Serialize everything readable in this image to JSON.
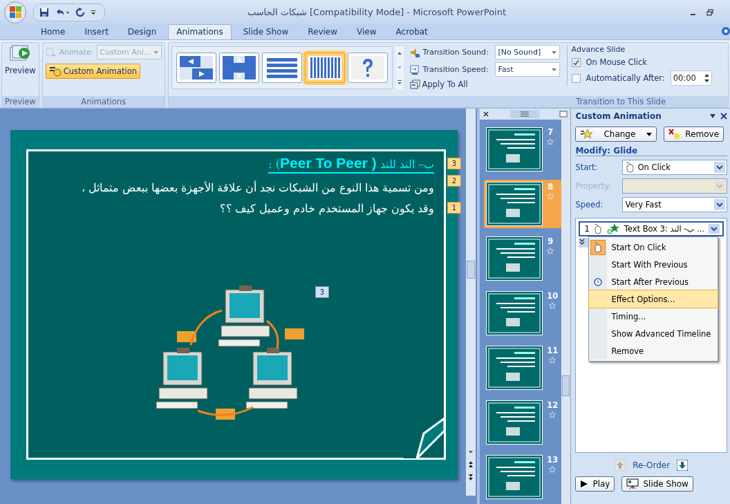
{
  "window": {
    "title": "شبكات الحاسب [Compatibility Mode] - Microsoft PowerPoint"
  },
  "tabs": [
    {
      "label": "Home",
      "selected": false
    },
    {
      "label": "Insert",
      "selected": false
    },
    {
      "label": "Design",
      "selected": false
    },
    {
      "label": "Animations",
      "selected": true
    },
    {
      "label": "Slide Show",
      "selected": false
    },
    {
      "label": "Review",
      "selected": false
    },
    {
      "label": "View",
      "selected": false
    },
    {
      "label": "Acrobat",
      "selected": false
    }
  ],
  "preview_group": {
    "button": "Preview",
    "label": "Preview"
  },
  "animations_group": {
    "animate_label": "Animate:",
    "animate_value": "Custom Ani...",
    "disabled": true,
    "custom_button": "Custom Animation",
    "label": "Animations"
  },
  "transition_group": {
    "gallery": [
      {
        "kind": "push",
        "selected": false
      },
      {
        "kind": "split",
        "selected": false
      },
      {
        "kind": "horizontal",
        "selected": false
      },
      {
        "kind": "vertical",
        "selected": true
      },
      {
        "kind": "random",
        "selected": false
      }
    ],
    "sound_label": "Transition Sound:",
    "sound_value": "[No Sound]",
    "speed_label": "Transition Speed:",
    "speed_value": "Fast",
    "apply_all": "Apply To All",
    "label": "Transition to This Slide"
  },
  "advance_group": {
    "title": "Advance Slide",
    "on_click": {
      "label": "On Mouse Click",
      "checked": true
    },
    "auto_after": {
      "label": "Automatically After:",
      "checked": false,
      "value": "00:00"
    }
  },
  "slide": {
    "heading": "ب– الند للند **( Peer To Peer**) :",
    "lines": [
      "ومن تسمية هذا النوع من الشبكات نجد أن علاقة الأجهزة بعضها ببعض متماثل ،",
      "وقد يكون جهاز المستخدم خادم وعميل  كيف ؟؟"
    ],
    "tags": [
      "3",
      "2",
      "1"
    ],
    "picture_tag": "3"
  },
  "thumbnails": [
    {
      "number": "7",
      "selected": false
    },
    {
      "number": "8",
      "selected": true
    },
    {
      "number": "9",
      "selected": false
    },
    {
      "number": "10",
      "selected": false
    },
    {
      "number": "11",
      "selected": false
    },
    {
      "number": "12",
      "selected": false
    },
    {
      "number": "13",
      "selected": false
    }
  ],
  "task_pane": {
    "title": "Custom Animation",
    "change": "Change",
    "remove": "Remove",
    "modify": "Modify: Glide",
    "start_label": "Start:",
    "start_value": "On Click",
    "property_label": "Property:",
    "property_disabled": true,
    "speed_label": "Speed:",
    "speed_value": "Very Fast",
    "item": {
      "number": "1",
      "label": "Text Box 3: ب- الند ..."
    },
    "menu": [
      {
        "label": "Start On Click",
        "kind": "click",
        "checked": true,
        "selected": false
      },
      {
        "label": "Start With Previous",
        "kind": "with",
        "checked": false,
        "selected": false
      },
      {
        "label": "Start After Previous",
        "kind": "after",
        "checked": false,
        "selected": false
      },
      {
        "label": "Effect Options...",
        "kind": "command",
        "checked": false,
        "selected": true
      },
      {
        "label": "Timing...",
        "kind": "command",
        "checked": false,
        "selected": false
      },
      {
        "label": "Show Advanced Timeline",
        "kind": "command",
        "checked": false,
        "selected": false
      },
      {
        "label": "Remove",
        "kind": "command",
        "checked": false,
        "selected": false
      }
    ],
    "reorder": "Re-Order",
    "play": "Play",
    "slide_show": "Slide Show"
  }
}
